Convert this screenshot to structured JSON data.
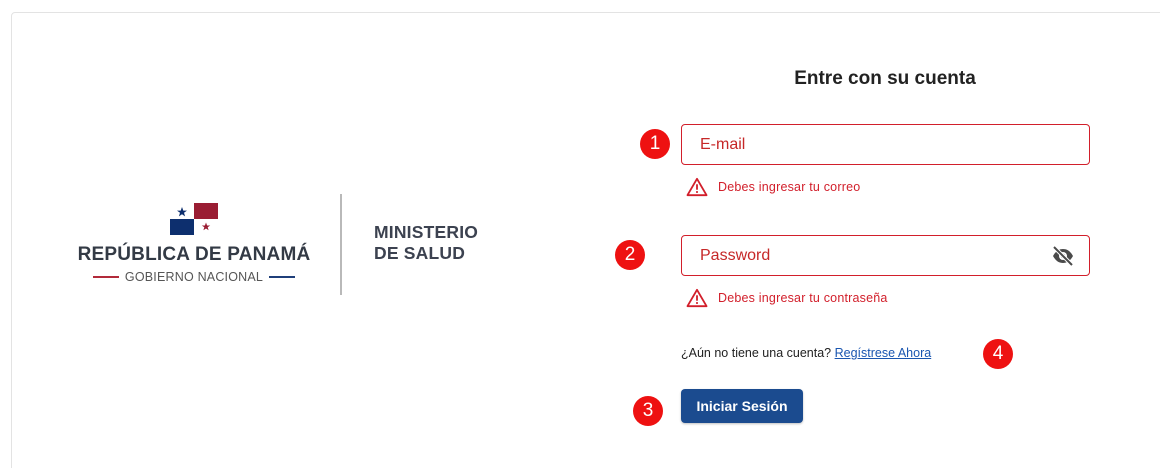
{
  "branding": {
    "country_name": "REPÚBLICA DE PANAMÁ",
    "government": "GOBIERNO NACIONAL",
    "ministry_line1": "MINISTERIO",
    "ministry_line2": "DE SALUD",
    "flag_colors": {
      "blue": "#0d2f6e",
      "red": "#9a1d33"
    }
  },
  "form": {
    "title": "Entre con su cuenta",
    "email_placeholder": "E-mail",
    "email_value": "",
    "email_error": "Debes ingresar tu correo",
    "password_placeholder": "Password",
    "password_value": "",
    "password_error": "Debes ingresar tu contraseña",
    "register_prompt": "¿Aún no tiene una cuenta?",
    "register_link": "Regístrese Ahora",
    "login_button": "Iniciar Sesión"
  },
  "annotations": {
    "badge_1": "1",
    "badge_2": "2",
    "badge_3": "3",
    "badge_4": "4"
  },
  "colors": {
    "error": "#d21f2b",
    "primary_button": "#1b4b8f",
    "link": "#1a56b0",
    "badge": "#ee1111"
  },
  "icons": {
    "flag": "panama-flag-icon",
    "password_toggle": "eye-slash-icon",
    "error": "warning-triangle-icon"
  }
}
